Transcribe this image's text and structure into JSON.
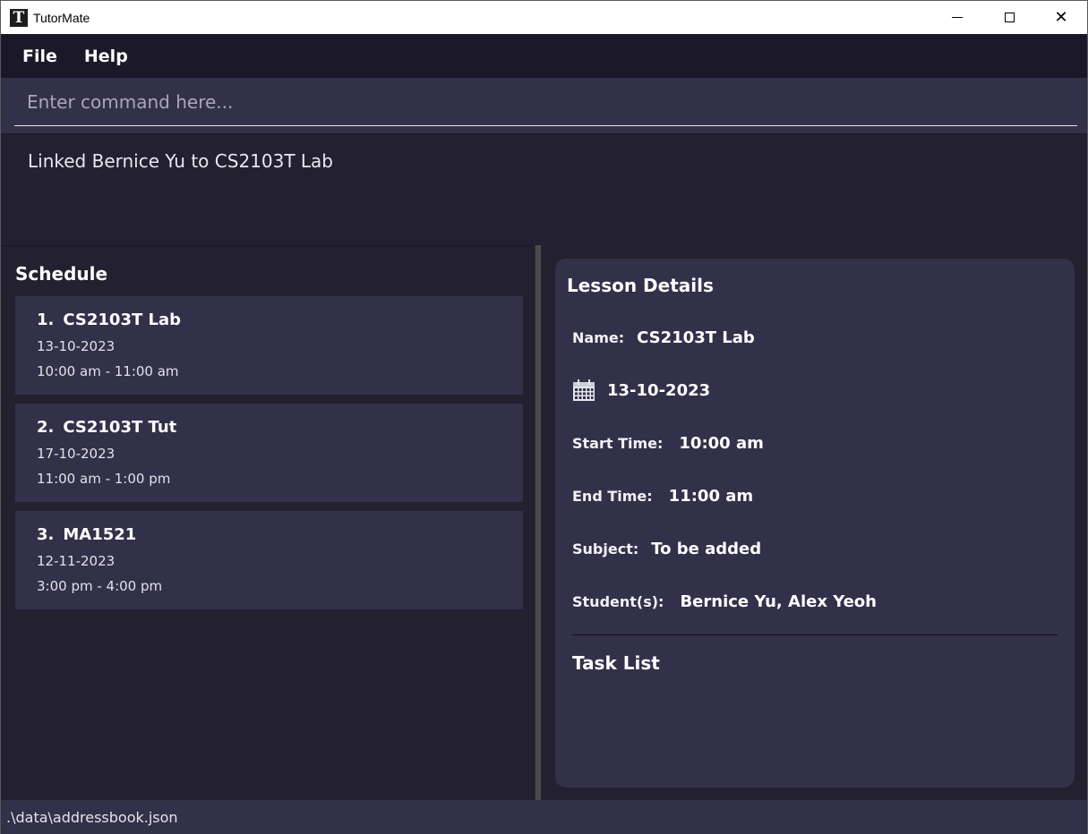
{
  "window": {
    "app_icon_letter": "T",
    "title": "TutorMate",
    "controls": {
      "minimize": "minimize-icon",
      "maximize": "maximize-icon",
      "close": "close-icon"
    }
  },
  "menu": {
    "items": [
      {
        "label": "File"
      },
      {
        "label": "Help"
      }
    ]
  },
  "command": {
    "placeholder": "Enter command here...",
    "value": ""
  },
  "result": {
    "message": "Linked Bernice Yu to CS2103T Lab"
  },
  "schedule": {
    "title": "Schedule",
    "lessons": [
      {
        "index": "1.",
        "name": "CS2103T Lab",
        "date": "13-10-2023",
        "time": "10:00 am - 11:00 am"
      },
      {
        "index": "2.",
        "name": "CS2103T Tut",
        "date": "17-10-2023",
        "time": "11:00 am - 1:00 pm"
      },
      {
        "index": "3.",
        "name": "MA1521",
        "date": "12-11-2023",
        "time": "3:00 pm - 4:00 pm"
      }
    ]
  },
  "details": {
    "title": "Lesson Details",
    "name_label": "Name:",
    "name_value": "CS2103T Lab",
    "date_icon": "calendar-icon",
    "date_value": "13-10-2023",
    "start_label": "Start Time:",
    "start_value": "10:00 am",
    "end_label": "End Time:",
    "end_value": "11:00 am",
    "subject_label": "Subject:",
    "subject_value": "To be added",
    "students_label": "Student(s):",
    "students_value": "Bernice Yu, Alex Yeoh",
    "task_list_title": "Task List"
  },
  "status": {
    "file_path": ".\\data\\addressbook.json"
  },
  "colors": {
    "background": "#23202f",
    "panel": "#33304a",
    "menubar": "#1b1929",
    "text": "#ffffff"
  }
}
